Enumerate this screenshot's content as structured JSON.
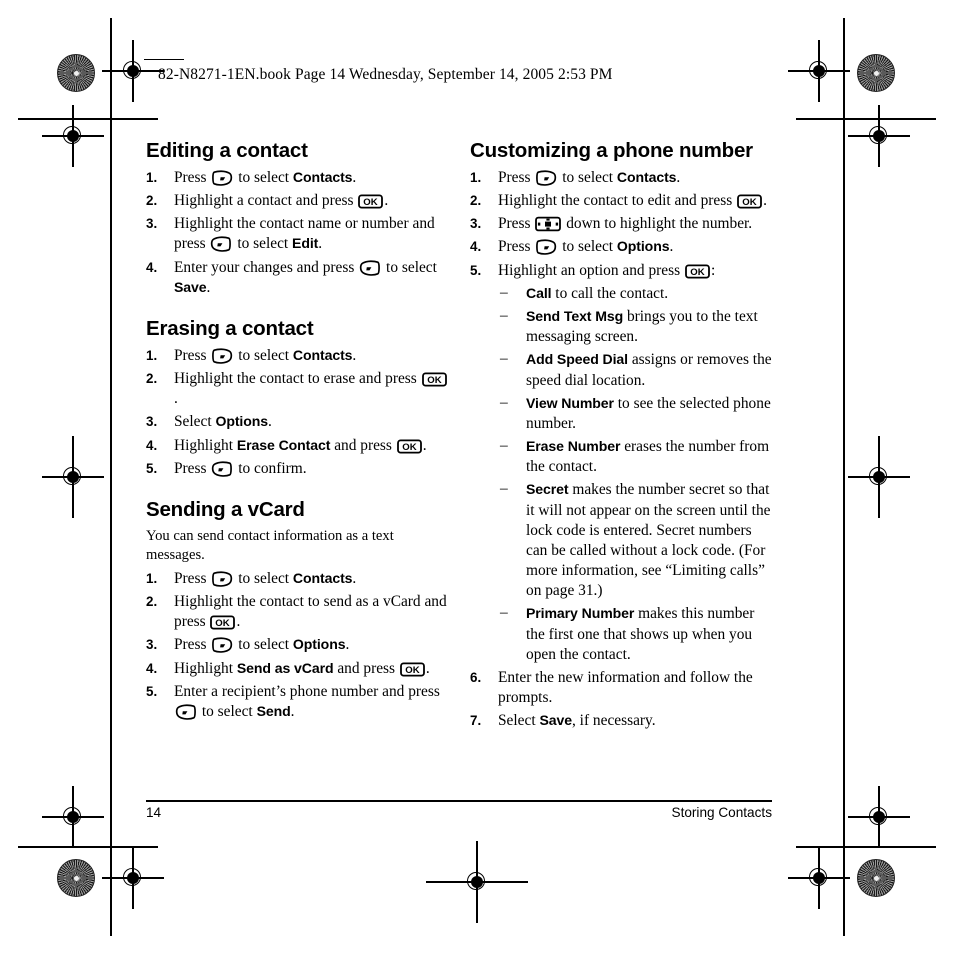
{
  "book_header": "82-N8271-1EN.book  Page 14  Wednesday, September 14, 2005  2:53 PM",
  "footer": {
    "page_number": "14",
    "running_head": "Storing Contacts"
  },
  "icons": {
    "softkey_right": "right-softkey-icon",
    "softkey_left": "left-softkey-icon",
    "ok_key": "ok-key-icon",
    "nav_key": "navigation-key-icon"
  },
  "left_column": {
    "sections": [
      {
        "heading": "Editing a contact",
        "steps": [
          {
            "num": "1.",
            "parts": [
              {
                "t": "text",
                "v": "Press "
              },
              {
                "t": "key",
                "v": "softkey_right"
              },
              {
                "t": "text",
                "v": " to select "
              },
              {
                "t": "bold",
                "v": "Contacts"
              },
              {
                "t": "text",
                "v": "."
              }
            ]
          },
          {
            "num": "2.",
            "parts": [
              {
                "t": "text",
                "v": "Highlight a contact and press "
              },
              {
                "t": "key",
                "v": "ok_key"
              },
              {
                "t": "text",
                "v": "."
              }
            ]
          },
          {
            "num": "3.",
            "parts": [
              {
                "t": "text",
                "v": "Highlight the contact name or number and press "
              },
              {
                "t": "key",
                "v": "softkey_left"
              },
              {
                "t": "text",
                "v": " to select "
              },
              {
                "t": "bold",
                "v": "Edit"
              },
              {
                "t": "text",
                "v": "."
              }
            ]
          },
          {
            "num": "4.",
            "parts": [
              {
                "t": "text",
                "v": "Enter your changes and press "
              },
              {
                "t": "key",
                "v": "softkey_left"
              },
              {
                "t": "text",
                "v": " to select "
              },
              {
                "t": "bold",
                "v": "Save"
              },
              {
                "t": "text",
                "v": "."
              }
            ]
          }
        ]
      },
      {
        "heading": "Erasing a contact",
        "steps": [
          {
            "num": "1.",
            "parts": [
              {
                "t": "text",
                "v": "Press "
              },
              {
                "t": "key",
                "v": "softkey_right"
              },
              {
                "t": "text",
                "v": " to select "
              },
              {
                "t": "bold",
                "v": "Contacts"
              },
              {
                "t": "text",
                "v": "."
              }
            ]
          },
          {
            "num": "2.",
            "parts": [
              {
                "t": "text",
                "v": "Highlight the contact to erase and press "
              },
              {
                "t": "key",
                "v": "ok_key"
              },
              {
                "t": "text",
                "v": "."
              }
            ]
          },
          {
            "num": "3.",
            "parts": [
              {
                "t": "text",
                "v": "Select "
              },
              {
                "t": "bold",
                "v": "Options"
              },
              {
                "t": "text",
                "v": "."
              }
            ]
          },
          {
            "num": "4.",
            "parts": [
              {
                "t": "text",
                "v": "Highlight "
              },
              {
                "t": "bold",
                "v": "Erase Contact"
              },
              {
                "t": "text",
                "v": " and press "
              },
              {
                "t": "key",
                "v": "ok_key"
              },
              {
                "t": "text",
                "v": "."
              }
            ]
          },
          {
            "num": "5.",
            "parts": [
              {
                "t": "text",
                "v": "Press "
              },
              {
                "t": "key",
                "v": "softkey_left"
              },
              {
                "t": "text",
                "v": " to confirm."
              }
            ]
          }
        ]
      },
      {
        "heading": "Sending a vCard",
        "intro": "You can send contact information as a text messages.",
        "steps": [
          {
            "num": "1.",
            "parts": [
              {
                "t": "text",
                "v": "Press "
              },
              {
                "t": "key",
                "v": "softkey_right"
              },
              {
                "t": "text",
                "v": " to select "
              },
              {
                "t": "bold",
                "v": "Contacts"
              },
              {
                "t": "text",
                "v": "."
              }
            ]
          },
          {
            "num": "2.",
            "parts": [
              {
                "t": "text",
                "v": "Highlight the contact to send as a vCard and press "
              },
              {
                "t": "key",
                "v": "ok_key"
              },
              {
                "t": "text",
                "v": "."
              }
            ]
          },
          {
            "num": "3.",
            "parts": [
              {
                "t": "text",
                "v": "Press "
              },
              {
                "t": "key",
                "v": "softkey_right"
              },
              {
                "t": "text",
                "v": " to select "
              },
              {
                "t": "bold",
                "v": "Options"
              },
              {
                "t": "text",
                "v": "."
              }
            ]
          },
          {
            "num": "4.",
            "parts": [
              {
                "t": "text",
                "v": "Highlight "
              },
              {
                "t": "bold",
                "v": "Send as vCard"
              },
              {
                "t": "text",
                "v": " and press "
              },
              {
                "t": "key",
                "v": "ok_key"
              },
              {
                "t": "text",
                "v": "."
              }
            ]
          },
          {
            "num": "5.",
            "parts": [
              {
                "t": "text",
                "v": "Enter a recipient’s phone number and press "
              },
              {
                "t": "key",
                "v": "softkey_left"
              },
              {
                "t": "text",
                "v": " to select "
              },
              {
                "t": "bold",
                "v": "Send"
              },
              {
                "t": "text",
                "v": "."
              }
            ]
          }
        ]
      }
    ]
  },
  "right_column": {
    "sections": [
      {
        "heading": "Customizing a phone number",
        "steps": [
          {
            "num": "1.",
            "parts": [
              {
                "t": "text",
                "v": "Press "
              },
              {
                "t": "key",
                "v": "softkey_right"
              },
              {
                "t": "text",
                "v": " to select "
              },
              {
                "t": "bold",
                "v": "Contacts"
              },
              {
                "t": "text",
                "v": "."
              }
            ]
          },
          {
            "num": "2.",
            "parts": [
              {
                "t": "text",
                "v": "Highlight the contact to edit and press "
              },
              {
                "t": "key",
                "v": "ok_key"
              },
              {
                "t": "text",
                "v": "."
              }
            ]
          },
          {
            "num": "3.",
            "parts": [
              {
                "t": "text",
                "v": "Press "
              },
              {
                "t": "key",
                "v": "nav_key"
              },
              {
                "t": "text",
                "v": " down to highlight the number."
              }
            ]
          },
          {
            "num": "4.",
            "parts": [
              {
                "t": "text",
                "v": "Press "
              },
              {
                "t": "key",
                "v": "softkey_right"
              },
              {
                "t": "text",
                "v": " to select "
              },
              {
                "t": "bold",
                "v": "Options"
              },
              {
                "t": "text",
                "v": "."
              }
            ]
          },
          {
            "num": "5.",
            "parts": [
              {
                "t": "text",
                "v": "Highlight an option and press "
              },
              {
                "t": "key",
                "v": "ok_key"
              },
              {
                "t": "text",
                "v": ":"
              }
            ],
            "subitems": [
              {
                "parts": [
                  {
                    "t": "bold",
                    "v": "Call"
                  },
                  {
                    "t": "text",
                    "v": " to call the contact."
                  }
                ]
              },
              {
                "parts": [
                  {
                    "t": "bold",
                    "v": "Send Text Msg"
                  },
                  {
                    "t": "text",
                    "v": " brings you to the text messaging screen."
                  }
                ]
              },
              {
                "parts": [
                  {
                    "t": "bold",
                    "v": "Add Speed Dial"
                  },
                  {
                    "t": "text",
                    "v": " assigns or removes the speed dial location."
                  }
                ]
              },
              {
                "parts": [
                  {
                    "t": "bold",
                    "v": "View Number"
                  },
                  {
                    "t": "text",
                    "v": " to see the selected phone number."
                  }
                ]
              },
              {
                "parts": [
                  {
                    "t": "bold",
                    "v": "Erase Number"
                  },
                  {
                    "t": "text",
                    "v": " erases the number from the contact."
                  }
                ]
              },
              {
                "parts": [
                  {
                    "t": "bold",
                    "v": "Secret"
                  },
                  {
                    "t": "text",
                    "v": " makes the number secret so that it will not appear on the screen until the lock code is entered. Secret numbers can be called without a lock code. (For more information, see “Limiting calls” on page 31.)"
                  }
                ]
              },
              {
                "parts": [
                  {
                    "t": "bold",
                    "v": "Primary Number"
                  },
                  {
                    "t": "text",
                    "v": " makes this number the first one that shows up when you open the contact."
                  }
                ]
              }
            ]
          },
          {
            "num": "6.",
            "parts": [
              {
                "t": "text",
                "v": "Enter the new information and follow the prompts."
              }
            ]
          },
          {
            "num": "7.",
            "parts": [
              {
                "t": "text",
                "v": "Select "
              },
              {
                "t": "bold",
                "v": "Save"
              },
              {
                "t": "text",
                "v": ", if necessary."
              }
            ]
          }
        ]
      }
    ]
  }
}
